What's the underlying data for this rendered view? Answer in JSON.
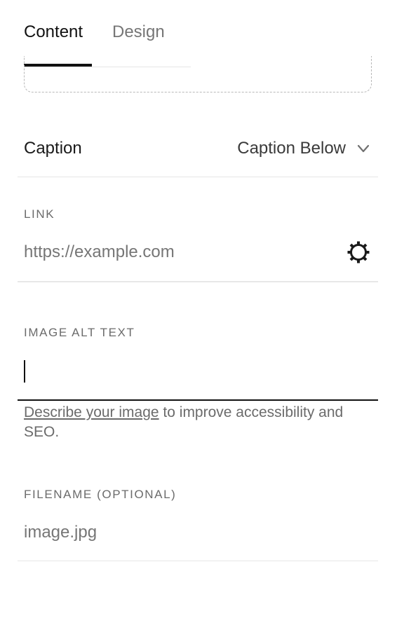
{
  "tabs": [
    {
      "label": "Content",
      "active": true
    },
    {
      "label": "Design",
      "active": false
    }
  ],
  "caption": {
    "label": "Caption",
    "value": "Caption Below"
  },
  "link": {
    "label": "LINK",
    "placeholder": "https://example.com",
    "settings_icon": "gear-icon"
  },
  "alt_text": {
    "label": "IMAGE ALT TEXT",
    "value": "",
    "help_link": "Describe your image",
    "help_rest": " to improve accessibility and SEO."
  },
  "filename": {
    "label": "FILENAME (OPTIONAL)",
    "placeholder": "image.jpg"
  },
  "colors": {
    "text": "#1a1a1a",
    "muted": "#767676",
    "active_underline": "#111111"
  }
}
